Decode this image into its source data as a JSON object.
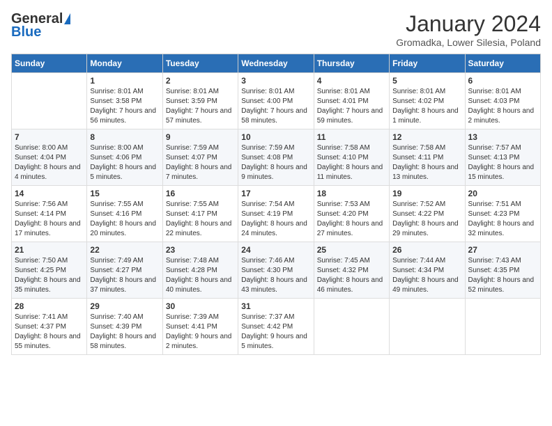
{
  "header": {
    "logo_general": "General",
    "logo_blue": "Blue",
    "title": "January 2024",
    "subtitle": "Gromadka, Lower Silesia, Poland"
  },
  "days_of_week": [
    "Sunday",
    "Monday",
    "Tuesday",
    "Wednesday",
    "Thursday",
    "Friday",
    "Saturday"
  ],
  "weeks": [
    [
      {
        "day": "",
        "sunrise": "",
        "sunset": "",
        "daylight": ""
      },
      {
        "day": "1",
        "sunrise": "Sunrise: 8:01 AM",
        "sunset": "Sunset: 3:58 PM",
        "daylight": "Daylight: 7 hours and 56 minutes."
      },
      {
        "day": "2",
        "sunrise": "Sunrise: 8:01 AM",
        "sunset": "Sunset: 3:59 PM",
        "daylight": "Daylight: 7 hours and 57 minutes."
      },
      {
        "day": "3",
        "sunrise": "Sunrise: 8:01 AM",
        "sunset": "Sunset: 4:00 PM",
        "daylight": "Daylight: 7 hours and 58 minutes."
      },
      {
        "day": "4",
        "sunrise": "Sunrise: 8:01 AM",
        "sunset": "Sunset: 4:01 PM",
        "daylight": "Daylight: 7 hours and 59 minutes."
      },
      {
        "day": "5",
        "sunrise": "Sunrise: 8:01 AM",
        "sunset": "Sunset: 4:02 PM",
        "daylight": "Daylight: 8 hours and 1 minute."
      },
      {
        "day": "6",
        "sunrise": "Sunrise: 8:01 AM",
        "sunset": "Sunset: 4:03 PM",
        "daylight": "Daylight: 8 hours and 2 minutes."
      }
    ],
    [
      {
        "day": "7",
        "sunrise": "Sunrise: 8:00 AM",
        "sunset": "Sunset: 4:04 PM",
        "daylight": "Daylight: 8 hours and 4 minutes."
      },
      {
        "day": "8",
        "sunrise": "Sunrise: 8:00 AM",
        "sunset": "Sunset: 4:06 PM",
        "daylight": "Daylight: 8 hours and 5 minutes."
      },
      {
        "day": "9",
        "sunrise": "Sunrise: 7:59 AM",
        "sunset": "Sunset: 4:07 PM",
        "daylight": "Daylight: 8 hours and 7 minutes."
      },
      {
        "day": "10",
        "sunrise": "Sunrise: 7:59 AM",
        "sunset": "Sunset: 4:08 PM",
        "daylight": "Daylight: 8 hours and 9 minutes."
      },
      {
        "day": "11",
        "sunrise": "Sunrise: 7:58 AM",
        "sunset": "Sunset: 4:10 PM",
        "daylight": "Daylight: 8 hours and 11 minutes."
      },
      {
        "day": "12",
        "sunrise": "Sunrise: 7:58 AM",
        "sunset": "Sunset: 4:11 PM",
        "daylight": "Daylight: 8 hours and 13 minutes."
      },
      {
        "day": "13",
        "sunrise": "Sunrise: 7:57 AM",
        "sunset": "Sunset: 4:13 PM",
        "daylight": "Daylight: 8 hours and 15 minutes."
      }
    ],
    [
      {
        "day": "14",
        "sunrise": "Sunrise: 7:56 AM",
        "sunset": "Sunset: 4:14 PM",
        "daylight": "Daylight: 8 hours and 17 minutes."
      },
      {
        "day": "15",
        "sunrise": "Sunrise: 7:55 AM",
        "sunset": "Sunset: 4:16 PM",
        "daylight": "Daylight: 8 hours and 20 minutes."
      },
      {
        "day": "16",
        "sunrise": "Sunrise: 7:55 AM",
        "sunset": "Sunset: 4:17 PM",
        "daylight": "Daylight: 8 hours and 22 minutes."
      },
      {
        "day": "17",
        "sunrise": "Sunrise: 7:54 AM",
        "sunset": "Sunset: 4:19 PM",
        "daylight": "Daylight: 8 hours and 24 minutes."
      },
      {
        "day": "18",
        "sunrise": "Sunrise: 7:53 AM",
        "sunset": "Sunset: 4:20 PM",
        "daylight": "Daylight: 8 hours and 27 minutes."
      },
      {
        "day": "19",
        "sunrise": "Sunrise: 7:52 AM",
        "sunset": "Sunset: 4:22 PM",
        "daylight": "Daylight: 8 hours and 29 minutes."
      },
      {
        "day": "20",
        "sunrise": "Sunrise: 7:51 AM",
        "sunset": "Sunset: 4:23 PM",
        "daylight": "Daylight: 8 hours and 32 minutes."
      }
    ],
    [
      {
        "day": "21",
        "sunrise": "Sunrise: 7:50 AM",
        "sunset": "Sunset: 4:25 PM",
        "daylight": "Daylight: 8 hours and 35 minutes."
      },
      {
        "day": "22",
        "sunrise": "Sunrise: 7:49 AM",
        "sunset": "Sunset: 4:27 PM",
        "daylight": "Daylight: 8 hours and 37 minutes."
      },
      {
        "day": "23",
        "sunrise": "Sunrise: 7:48 AM",
        "sunset": "Sunset: 4:28 PM",
        "daylight": "Daylight: 8 hours and 40 minutes."
      },
      {
        "day": "24",
        "sunrise": "Sunrise: 7:46 AM",
        "sunset": "Sunset: 4:30 PM",
        "daylight": "Daylight: 8 hours and 43 minutes."
      },
      {
        "day": "25",
        "sunrise": "Sunrise: 7:45 AM",
        "sunset": "Sunset: 4:32 PM",
        "daylight": "Daylight: 8 hours and 46 minutes."
      },
      {
        "day": "26",
        "sunrise": "Sunrise: 7:44 AM",
        "sunset": "Sunset: 4:34 PM",
        "daylight": "Daylight: 8 hours and 49 minutes."
      },
      {
        "day": "27",
        "sunrise": "Sunrise: 7:43 AM",
        "sunset": "Sunset: 4:35 PM",
        "daylight": "Daylight: 8 hours and 52 minutes."
      }
    ],
    [
      {
        "day": "28",
        "sunrise": "Sunrise: 7:41 AM",
        "sunset": "Sunset: 4:37 PM",
        "daylight": "Daylight: 8 hours and 55 minutes."
      },
      {
        "day": "29",
        "sunrise": "Sunrise: 7:40 AM",
        "sunset": "Sunset: 4:39 PM",
        "daylight": "Daylight: 8 hours and 58 minutes."
      },
      {
        "day": "30",
        "sunrise": "Sunrise: 7:39 AM",
        "sunset": "Sunset: 4:41 PM",
        "daylight": "Daylight: 9 hours and 2 minutes."
      },
      {
        "day": "31",
        "sunrise": "Sunrise: 7:37 AM",
        "sunset": "Sunset: 4:42 PM",
        "daylight": "Daylight: 9 hours and 5 minutes."
      },
      {
        "day": "",
        "sunrise": "",
        "sunset": "",
        "daylight": ""
      },
      {
        "day": "",
        "sunrise": "",
        "sunset": "",
        "daylight": ""
      },
      {
        "day": "",
        "sunrise": "",
        "sunset": "",
        "daylight": ""
      }
    ]
  ]
}
